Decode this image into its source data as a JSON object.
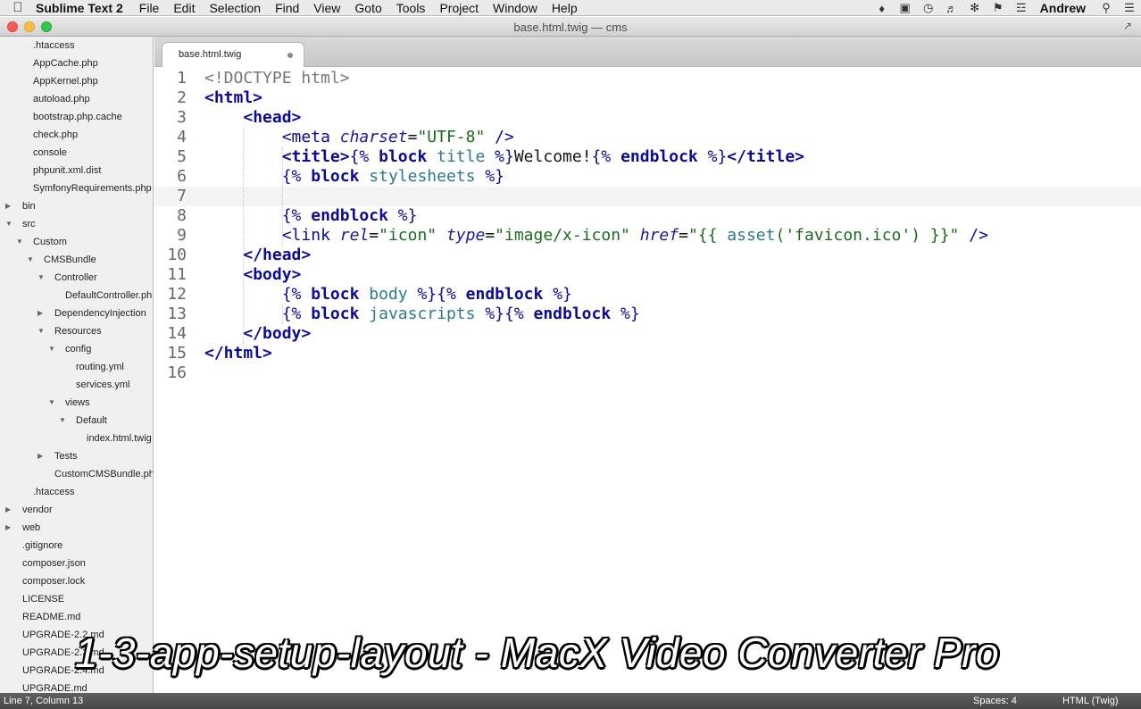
{
  "menubar": {
    "app_name": "Sublime Text 2",
    "items": [
      "File",
      "Edit",
      "Selection",
      "Find",
      "View",
      "Goto",
      "Tools",
      "Project",
      "Window",
      "Help"
    ],
    "user": "Andrew"
  },
  "window": {
    "title": "base.html.twig — cms"
  },
  "sidebar": {
    "items": [
      {
        "label": ".htaccess",
        "indent": 2,
        "arrow": ""
      },
      {
        "label": "AppCache.php",
        "indent": 2,
        "arrow": ""
      },
      {
        "label": "AppKernel.php",
        "indent": 2,
        "arrow": ""
      },
      {
        "label": "autoload.php",
        "indent": 2,
        "arrow": ""
      },
      {
        "label": "bootstrap.php.cache",
        "indent": 2,
        "arrow": ""
      },
      {
        "label": "check.php",
        "indent": 2,
        "arrow": ""
      },
      {
        "label": "console",
        "indent": 2,
        "arrow": ""
      },
      {
        "label": "phpunit.xml.dist",
        "indent": 2,
        "arrow": ""
      },
      {
        "label": "SymfonyRequirements.php",
        "indent": 2,
        "arrow": ""
      },
      {
        "label": "bin",
        "indent": 1,
        "arrow": "closed"
      },
      {
        "label": "src",
        "indent": 1,
        "arrow": "open"
      },
      {
        "label": "Custom",
        "indent": 2,
        "arrow": "open"
      },
      {
        "label": "CMSBundle",
        "indent": 3,
        "arrow": "open"
      },
      {
        "label": "Controller",
        "indent": 4,
        "arrow": "open"
      },
      {
        "label": "DefaultController.php",
        "indent": 5,
        "arrow": ""
      },
      {
        "label": "DependencyInjection",
        "indent": 4,
        "arrow": "closed"
      },
      {
        "label": "Resources",
        "indent": 4,
        "arrow": "open"
      },
      {
        "label": "config",
        "indent": 5,
        "arrow": "open"
      },
      {
        "label": "routing.yml",
        "indent": 6,
        "arrow": ""
      },
      {
        "label": "services.yml",
        "indent": 6,
        "arrow": ""
      },
      {
        "label": "views",
        "indent": 5,
        "arrow": "open"
      },
      {
        "label": "Default",
        "indent": 6,
        "arrow": "open"
      },
      {
        "label": "index.html.twig",
        "indent": 7,
        "arrow": ""
      },
      {
        "label": "Tests",
        "indent": 4,
        "arrow": "closed"
      },
      {
        "label": "CustomCMSBundle.php",
        "indent": 4,
        "arrow": ""
      },
      {
        "label": ".htaccess",
        "indent": 2,
        "arrow": ""
      },
      {
        "label": "vendor",
        "indent": 1,
        "arrow": "closed"
      },
      {
        "label": "web",
        "indent": 1,
        "arrow": "closed"
      },
      {
        "label": ".gitignore",
        "indent": 1,
        "arrow": ""
      },
      {
        "label": "composer.json",
        "indent": 1,
        "arrow": ""
      },
      {
        "label": "composer.lock",
        "indent": 1,
        "arrow": ""
      },
      {
        "label": "LICENSE",
        "indent": 1,
        "arrow": ""
      },
      {
        "label": "README.md",
        "indent": 1,
        "arrow": ""
      },
      {
        "label": "UPGRADE-2.2.md",
        "indent": 1,
        "arrow": ""
      },
      {
        "label": "UPGRADE-2.3.md",
        "indent": 1,
        "arrow": ""
      },
      {
        "label": "UPGRADE-2.4.md",
        "indent": 1,
        "arrow": ""
      },
      {
        "label": "UPGRADE.md",
        "indent": 1,
        "arrow": ""
      }
    ]
  },
  "tab": {
    "label": "base.html.twig"
  },
  "editor": {
    "current_line": 7,
    "lines": [
      {
        "n": "1",
        "indent": 0,
        "tokens": [
          [
            "doc",
            "<!DOCTYPE html>"
          ]
        ]
      },
      {
        "n": "2",
        "indent": 0,
        "tokens": [
          [
            "tag",
            "<html>"
          ]
        ]
      },
      {
        "n": "3",
        "indent": 1,
        "tokens": [
          [
            "tag",
            "<head>"
          ]
        ]
      },
      {
        "n": "4",
        "indent": 2,
        "tokens": [
          [
            "tagb",
            "<meta "
          ],
          [
            "attr",
            "charset"
          ],
          [
            "plain",
            "="
          ],
          [
            "str",
            "\"UTF-8\""
          ],
          [
            "tagb",
            " />"
          ]
        ]
      },
      {
        "n": "5",
        "indent": 2,
        "tokens": [
          [
            "tag",
            "<title>"
          ],
          [
            "tw",
            "{% "
          ],
          [
            "kw",
            "block "
          ],
          [
            "name",
            "title "
          ],
          [
            "tw",
            "%}"
          ],
          [
            "plain",
            "Welcome!"
          ],
          [
            "tw",
            "{% "
          ],
          [
            "kw",
            "endblock "
          ],
          [
            "tw",
            "%}"
          ],
          [
            "tag",
            "</title>"
          ]
        ]
      },
      {
        "n": "6",
        "indent": 2,
        "tokens": [
          [
            "tw",
            "{% "
          ],
          [
            "kw",
            "block "
          ],
          [
            "name",
            "stylesheets "
          ],
          [
            "tw",
            "%}"
          ]
        ]
      },
      {
        "n": "7",
        "indent": 0,
        "tokens": []
      },
      {
        "n": "8",
        "indent": 2,
        "tokens": [
          [
            "tw",
            "{% "
          ],
          [
            "kw",
            "endblock "
          ],
          [
            "tw",
            "%}"
          ]
        ]
      },
      {
        "n": "9",
        "indent": 2,
        "tokens": [
          [
            "tagb",
            "<link "
          ],
          [
            "attr",
            "rel"
          ],
          [
            "plain",
            "="
          ],
          [
            "str",
            "\"icon\" "
          ],
          [
            "attr",
            "type"
          ],
          [
            "plain",
            "="
          ],
          [
            "str",
            "\"image/x-icon\" "
          ],
          [
            "attr",
            "href"
          ],
          [
            "plain",
            "="
          ],
          [
            "str",
            "\"{{ "
          ],
          [
            "name",
            "asset"
          ],
          [
            "str",
            "('favicon.ico') }}\""
          ],
          [
            "tagb",
            " />"
          ]
        ]
      },
      {
        "n": "10",
        "indent": 1,
        "tokens": [
          [
            "tag",
            "</head>"
          ]
        ]
      },
      {
        "n": "11",
        "indent": 1,
        "tokens": [
          [
            "tag",
            "<body>"
          ]
        ]
      },
      {
        "n": "12",
        "indent": 2,
        "tokens": [
          [
            "tw",
            "{% "
          ],
          [
            "kw",
            "block "
          ],
          [
            "name",
            "body "
          ],
          [
            "tw",
            "%}{% "
          ],
          [
            "kw",
            "endblock "
          ],
          [
            "tw",
            "%}"
          ]
        ]
      },
      {
        "n": "13",
        "indent": 2,
        "tokens": [
          [
            "tw",
            "{% "
          ],
          [
            "kw",
            "block "
          ],
          [
            "name",
            "javascripts "
          ],
          [
            "tw",
            "%}{% "
          ],
          [
            "kw",
            "endblock "
          ],
          [
            "tw",
            "%}"
          ]
        ]
      },
      {
        "n": "14",
        "indent": 1,
        "tokens": [
          [
            "tag",
            "</body>"
          ]
        ]
      },
      {
        "n": "15",
        "indent": 0,
        "tokens": [
          [
            "tag",
            "</html>"
          ]
        ]
      },
      {
        "n": "16",
        "indent": 0,
        "tokens": []
      }
    ]
  },
  "watermark": "1-3-app-setup-layout - MacX Video Converter Pro",
  "status": {
    "position": "Line 7, Column 13",
    "spaces": "Spaces: 4",
    "syntax": "HTML (Twig)"
  }
}
